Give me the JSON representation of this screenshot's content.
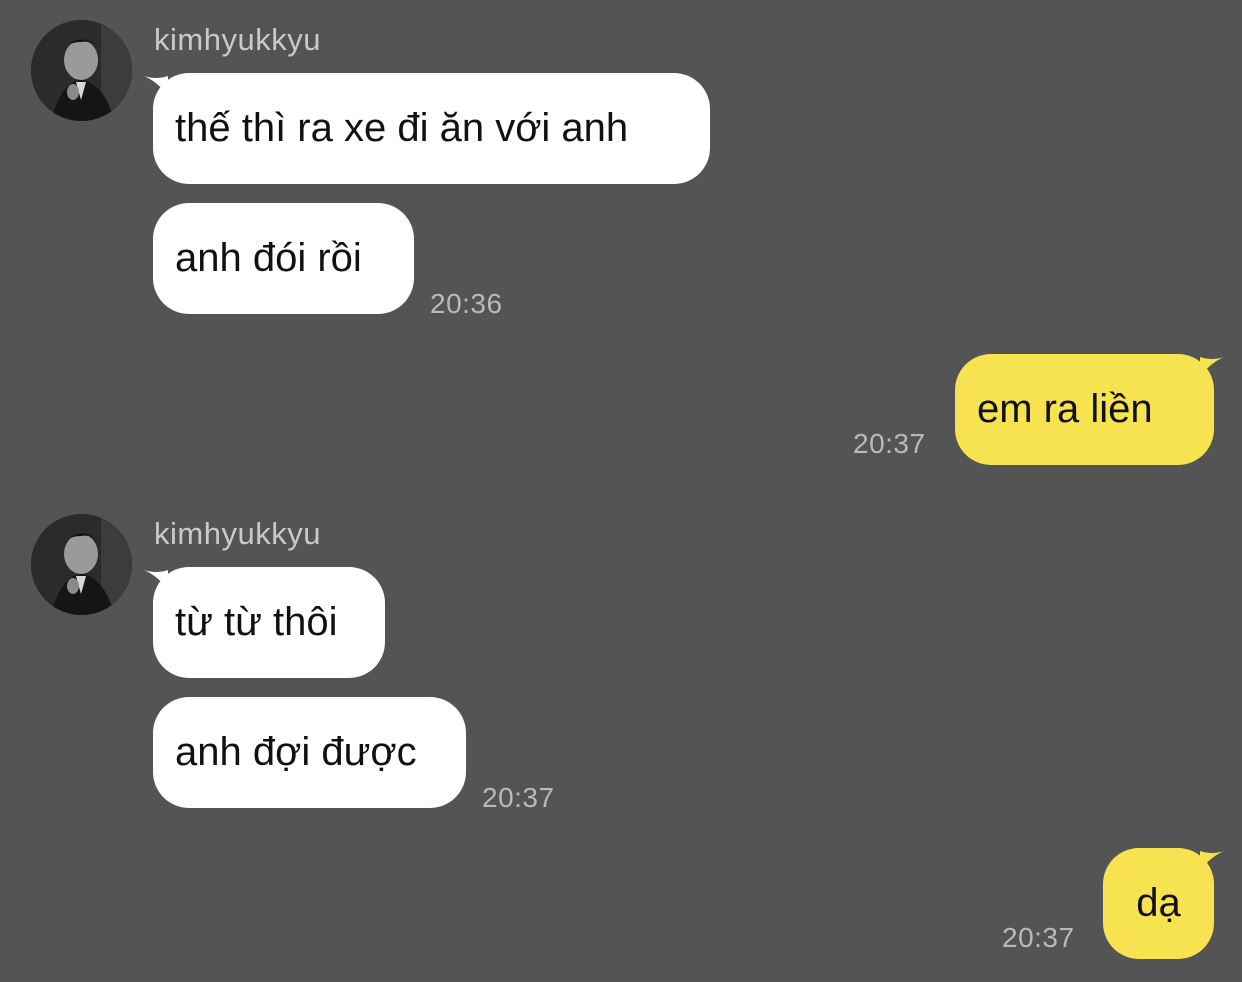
{
  "colors": {
    "background": "#555455",
    "incoming_bubble": "#ffffff",
    "outgoing_bubble": "#f7e34f",
    "meta_text": "#b9b9b9"
  },
  "messages": [
    {
      "sender": "kimhyukkyu",
      "avatar_icon": "profile-avatar-icon",
      "bubbles": [
        "thế thì ra xe đi ăn với anh",
        "anh đói rồi"
      ],
      "time": "20:36"
    },
    {
      "sender": "me",
      "bubbles": [
        "em ra liền"
      ],
      "time": "20:37"
    },
    {
      "sender": "kimhyukkyu",
      "avatar_icon": "profile-avatar-icon",
      "bubbles": [
        "từ từ thôi",
        "anh đợi được"
      ],
      "time": "20:37"
    },
    {
      "sender": "me",
      "bubbles": [
        "dạ"
      ],
      "time": "20:37"
    }
  ]
}
